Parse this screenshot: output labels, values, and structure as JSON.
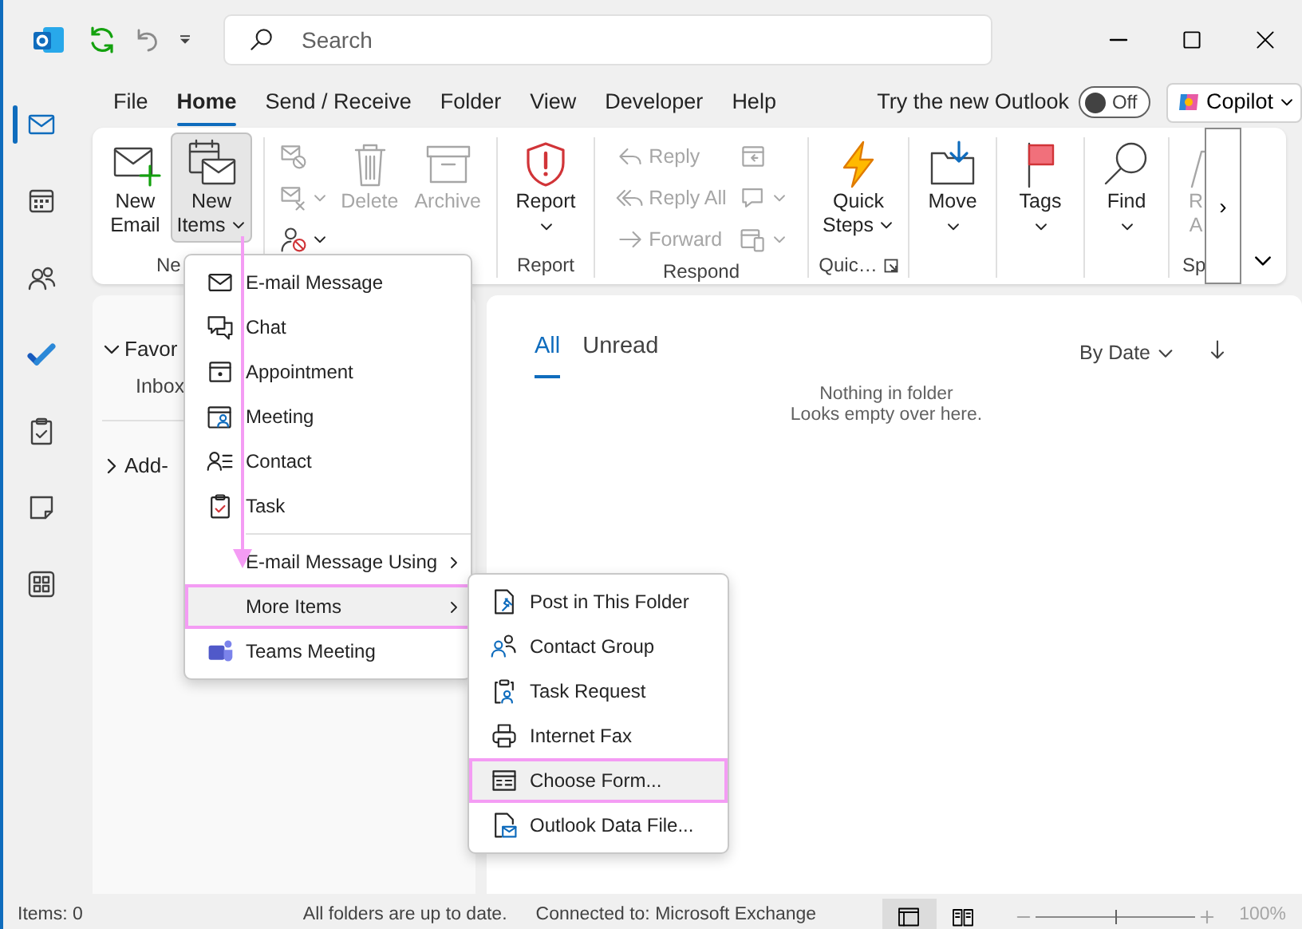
{
  "title_bar": {
    "search": {
      "placeholder": "Search"
    }
  },
  "nav_rail": [
    {
      "selected": true
    },
    {
      "selected": false
    },
    {
      "selected": false
    },
    {
      "selected": false
    },
    {
      "selected": false
    },
    {
      "selected": false
    },
    {
      "selected": false
    }
  ],
  "ribbon_tabs": [
    {
      "label": "File",
      "selected": false
    },
    {
      "label": "Home",
      "selected": true
    },
    {
      "label": "Send / Receive",
      "selected": false
    },
    {
      "label": "Folder",
      "selected": false
    },
    {
      "label": "View",
      "selected": false
    },
    {
      "label": "Developer",
      "selected": false
    },
    {
      "label": "Help",
      "selected": false
    }
  ],
  "try_new_outlook": {
    "label": "Try the new Outlook",
    "toggle": {
      "label": "Off",
      "on": false
    }
  },
  "copilot": {
    "label": "Copilot"
  },
  "ribbon_groups": [
    {
      "label": "Ne",
      "buttons": [
        {
          "kind": "large",
          "label": "New Email",
          "dropdown": false,
          "disabled": false,
          "pressed": false
        },
        {
          "kind": "stacked",
          "label": "New Items",
          "dropdown": true,
          "disabled": false,
          "pressed": true
        }
      ]
    },
    {
      "buttons": [
        {
          "kind": "icon",
          "dropdown": false,
          "disabled": true,
          "pressed": false
        },
        {
          "kind": "icon",
          "dropdown": true,
          "disabled": true,
          "pressed": false
        },
        {
          "kind": "icon",
          "dropdown": true,
          "disabled": false,
          "pressed": false
        },
        {
          "kind": "large",
          "label": "Delete",
          "dropdown": false,
          "disabled": true,
          "pressed": false
        },
        {
          "kind": "large",
          "label": "Archive",
          "dropdown": false,
          "disabled": true,
          "pressed": false
        }
      ]
    },
    {
      "label": "Report",
      "buttons": [
        {
          "kind": "large",
          "label": "Report",
          "dropdown": true,
          "disabled": false,
          "pressed": false
        }
      ]
    },
    {
      "label": "Respond",
      "buttons": [
        {
          "kind": "small",
          "label": "Reply",
          "dropdown": false,
          "disabled": true,
          "pressed": false
        },
        {
          "kind": "small",
          "label": "Reply All",
          "dropdown": false,
          "disabled": true,
          "pressed": false
        },
        {
          "kind": "small",
          "label": "Forward",
          "dropdown": false,
          "disabled": true,
          "pressed": false
        },
        {
          "kind": "icon",
          "dropdown": false,
          "disabled": true,
          "pressed": false
        },
        {
          "kind": "icon",
          "dropdown": true,
          "disabled": true,
          "pressed": false
        },
        {
          "kind": "icon",
          "dropdown": true,
          "disabled": true,
          "pressed": false
        }
      ]
    },
    {
      "label": "Quic…",
      "dialog_launcher": true,
      "buttons": [
        {
          "kind": "stacked",
          "label": "Quick Steps",
          "dropdown": true,
          "disabled": false,
          "pressed": false
        }
      ]
    },
    {
      "buttons": [
        {
          "kind": "large",
          "label": "Move",
          "dropdown": true,
          "disabled": false,
          "pressed": false
        }
      ]
    },
    {
      "buttons": [
        {
          "kind": "large",
          "label": "Tags",
          "dropdown": true,
          "disabled": false,
          "pressed": false
        }
      ]
    },
    {
      "buttons": [
        {
          "kind": "large",
          "label": "Find",
          "dropdown": true,
          "disabled": false,
          "pressed": false
        }
      ]
    },
    {
      "label": "Sp",
      "buttons": [
        {
          "kind": "large",
          "label": "R A",
          "dropdown": false,
          "disabled": true,
          "pressed": false
        }
      ]
    }
  ],
  "ribbon_scroll": {
    "label": "›"
  },
  "folder_pane": {
    "sections": [
      {
        "label": "Favor",
        "expanded": true,
        "items": [
          "Inbox"
        ]
      },
      {
        "label": "Add-",
        "expanded": false
      }
    ]
  },
  "message_list": {
    "tabs": [
      {
        "label": "All",
        "selected": true
      },
      {
        "label": "Unread",
        "selected": false
      }
    ],
    "sort": {
      "label": "By Date"
    },
    "empty_title": "Nothing in folder",
    "empty_subtitle": "Looks empty over here."
  },
  "new_items_menu": {
    "sections": [
      [
        {
          "label": "E-mail Message",
          "submenu": false,
          "selected": false
        },
        {
          "label": "Chat",
          "submenu": false,
          "selected": false
        },
        {
          "label": "Appointment",
          "submenu": false,
          "selected": false
        },
        {
          "label": "Meeting",
          "submenu": false,
          "selected": false
        },
        {
          "label": "Contact",
          "submenu": false,
          "selected": false
        },
        {
          "label": "Task",
          "submenu": false,
          "selected": false
        }
      ],
      [
        {
          "label": "E-mail Message Using",
          "submenu": true,
          "selected": false
        },
        {
          "label": "More Items",
          "submenu": true,
          "selected": true
        },
        {
          "label": "Teams Meeting",
          "submenu": false,
          "selected": false
        }
      ]
    ]
  },
  "more_items_menu": {
    "items": [
      {
        "label": "Post in This Folder",
        "selected": false
      },
      {
        "label": "Contact Group",
        "selected": false
      },
      {
        "label": "Task Request",
        "selected": false
      },
      {
        "label": "Internet Fax",
        "selected": false
      },
      {
        "label": "Choose Form...",
        "selected": true
      },
      {
        "label": "Outlook Data File...",
        "selected": false
      }
    ]
  },
  "status_bar": {
    "items": "Items: 0",
    "sync": "All folders are up to date.",
    "connection": "Connected to: Microsoft Exchange",
    "views": [
      {
        "selected": true
      },
      {
        "selected": false
      }
    ],
    "zoom": {
      "level": 0.5,
      "reading": "100%"
    }
  }
}
